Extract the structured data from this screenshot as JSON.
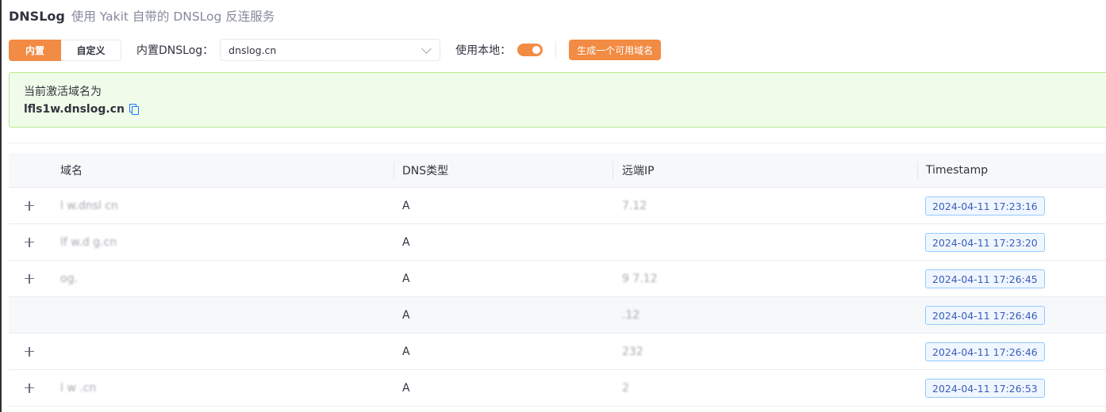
{
  "header": {
    "title": "DNSLog",
    "subtitle": "使用 Yakit 自带的 DNSLog 反连服务"
  },
  "toolbar": {
    "mode_builtin": "内置",
    "mode_custom": "自定义",
    "builtin_label": "内置DNSLog：",
    "builtin_value": "dnslog.cn",
    "local_label": "使用本地：",
    "local_enabled": true,
    "generate_label": "生成一个可用域名"
  },
  "active_domain": {
    "title": "当前激活域名为",
    "value": "lfls1w.dnslog.cn"
  },
  "table": {
    "columns": [
      "域名",
      "DNS类型",
      "远端IP",
      "Timestamp"
    ],
    "rows": [
      {
        "domain": "l  w.dnsl  cn",
        "type": "A",
        "remote": "        7.12",
        "timestamp": "2024-04-11 17:23:16"
      },
      {
        "domain": "lf    w.d   g.cn",
        "type": "A",
        "remote": "  ",
        "timestamp": "2024-04-11 17:23:20"
      },
      {
        "domain": "         og.  ",
        "type": "A",
        "remote": "9      7.12",
        "timestamp": "2024-04-11 17:26:45"
      },
      {
        "domain": "          ",
        "type": "A",
        "remote": "       .12",
        "timestamp": "2024-04-11 17:26:46"
      },
      {
        "domain": "          ",
        "type": "A",
        "remote": "  232     ",
        "timestamp": "2024-04-11 17:26:46"
      },
      {
        "domain": "l   w    .cn",
        "type": "A",
        "remote": "       2",
        "timestamp": "2024-04-11 17:26:53"
      }
    ]
  },
  "colors": {
    "accent": "#f28b44",
    "success_bg": "#f0fce9",
    "success_border": "#b7eb8f",
    "tag_border": "#91caff",
    "tag_text": "#3a5dbb"
  }
}
